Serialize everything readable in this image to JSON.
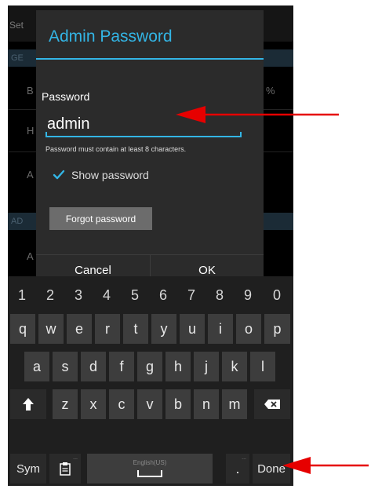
{
  "background": {
    "back_label": "Set",
    "band1_label": "GE",
    "row_letters": [
      "B",
      "H",
      "A"
    ],
    "percent": "%",
    "band2_label": "AD",
    "row_letter2": "A"
  },
  "dialog": {
    "title": "Admin Password",
    "password_label": "Password",
    "password_value": "admin",
    "hint": "Password must contain at least 8 characters.",
    "show_password_label": "Show password",
    "show_password_checked": true,
    "forgot_button": "Forgot password",
    "cancel_button": "Cancel",
    "ok_button": "OK"
  },
  "keyboard": {
    "number_row": [
      "1",
      "2",
      "3",
      "4",
      "5",
      "6",
      "7",
      "8",
      "9",
      "0"
    ],
    "row1": [
      "q",
      "w",
      "e",
      "r",
      "t",
      "y",
      "u",
      "i",
      "o",
      "p"
    ],
    "row2": [
      "a",
      "s",
      "d",
      "f",
      "g",
      "h",
      "j",
      "k",
      "l"
    ],
    "row3": [
      "z",
      "x",
      "c",
      "v",
      "b",
      "n",
      "m"
    ],
    "sym_key": "Sym",
    "space_hint": "English(US)",
    "period_key": ".",
    "done_key": "Done",
    "settings_mark": "...",
    "period_mark": "..."
  },
  "colors": {
    "accent": "#33b5e5",
    "annotation_arrow": "#e60000",
    "key_background": "#3d3d3d"
  },
  "icons": {
    "shift": "shift-arrow-icon",
    "backspace": "backspace-icon",
    "clipboard": "clipboard-icon",
    "space": "space-bar-icon",
    "checkmark": "checkmark-icon"
  }
}
